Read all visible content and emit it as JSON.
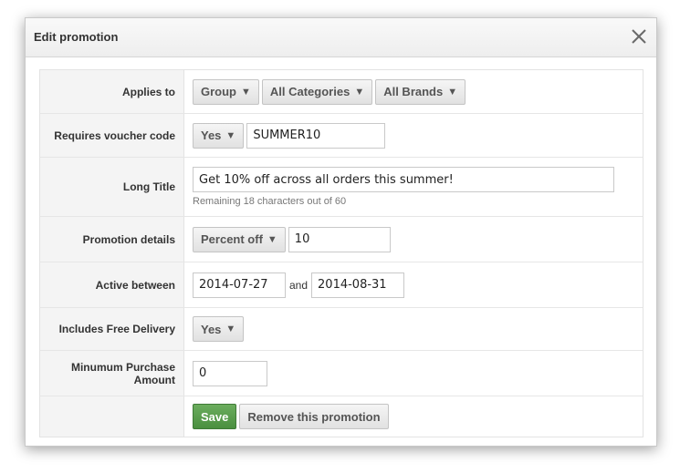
{
  "dialog": {
    "title": "Edit promotion",
    "close_icon": "close-icon"
  },
  "applies_to": {
    "label": "Applies to",
    "group": "Group",
    "categories": "All Categories",
    "brands": "All Brands",
    "caret": "▼"
  },
  "voucher": {
    "label": "Requires voucher code",
    "select": "Yes",
    "code": "SUMMER10"
  },
  "long_title": {
    "label": "Long Title",
    "value": "Get 10% off across all orders this summer!",
    "hint": "Remaining 18 characters out of 60"
  },
  "details": {
    "label": "Promotion details",
    "type": "Percent off",
    "amount": "10"
  },
  "active": {
    "label": "Active between",
    "start": "2014-07-27",
    "and_text": "and",
    "end": "2014-08-31"
  },
  "delivery": {
    "label": "Includes Free Delivery",
    "select": "Yes"
  },
  "minimum": {
    "label_line1": "Minumum Purchase",
    "label_line2": "Amount",
    "value": "0"
  },
  "actions": {
    "save": "Save",
    "remove": "Remove this promotion"
  },
  "colors": {
    "save_button": "#5a9e4d",
    "label_background": "#f4f4f4"
  }
}
